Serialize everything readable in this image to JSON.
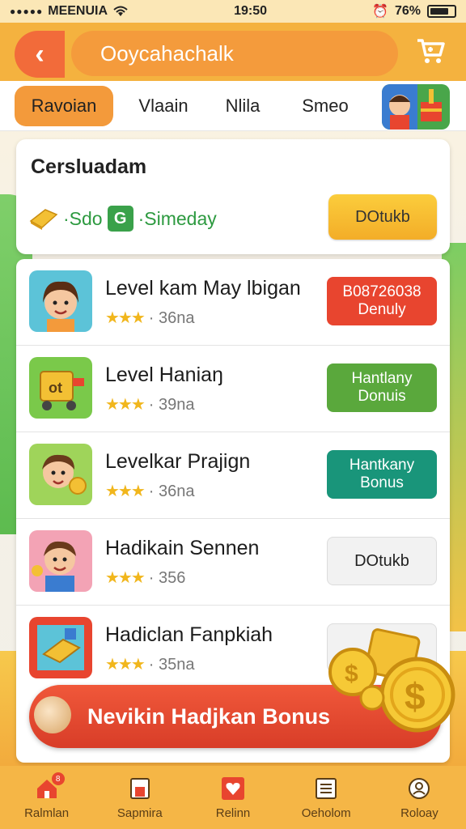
{
  "status_bar": {
    "carrier": "MEENUIA",
    "time": "19:50",
    "battery": "76%"
  },
  "header": {
    "title": "Ooycahachalk"
  },
  "tabs": [
    {
      "label": "Ravoian",
      "active": true
    },
    {
      "label": "Vlaain",
      "active": false
    },
    {
      "label": "Nlila",
      "active": false
    },
    {
      "label": "Smeo",
      "active": false
    }
  ],
  "summary": {
    "title": "Cersluadam",
    "stat_left": "·Sdo",
    "stat_right": "·Simeday",
    "badge": "G",
    "button_label": "DOtukb"
  },
  "items": [
    {
      "title": "Level kam May lbigan",
      "rating": "3",
      "meta": "· 36na",
      "button": "B08726038\nDenuly",
      "button_style": "red"
    },
    {
      "title": "Level Haniaŋ",
      "rating": "3",
      "meta": "· 39na",
      "button": "Hantlany\nDonuis",
      "button_style": "green"
    },
    {
      "title": "Levelkar Prajign",
      "rating": "3",
      "meta": "· 36na",
      "button": "Hantkany\nBonus",
      "button_style": "teal"
    },
    {
      "title": "Hadikain Sennen",
      "rating": "3",
      "meta": "· 356",
      "button": "DOtukb",
      "button_style": "light"
    },
    {
      "title": "Hadiclan Fanpkiah",
      "rating": "3",
      "meta": "· 35na",
      "button": "",
      "button_style": "light"
    }
  ],
  "cta": {
    "label": "Nevikin Hadjkan Bonus"
  },
  "bottom_nav": [
    {
      "label": "Ralmlan",
      "icon": "home-icon",
      "badge": "8"
    },
    {
      "label": "Sapmira",
      "icon": "flask-icon"
    },
    {
      "label": "Relinn",
      "icon": "heart-icon"
    },
    {
      "label": "Oeholom",
      "icon": "list-icon"
    },
    {
      "label": "Roloay",
      "icon": "profile-icon"
    }
  ],
  "colors": {
    "accent_orange": "#f4b23f",
    "back_red": "#f26b3a",
    "cta_red": "#e8452f",
    "green": "#5aa83c",
    "teal": "#19957a"
  }
}
